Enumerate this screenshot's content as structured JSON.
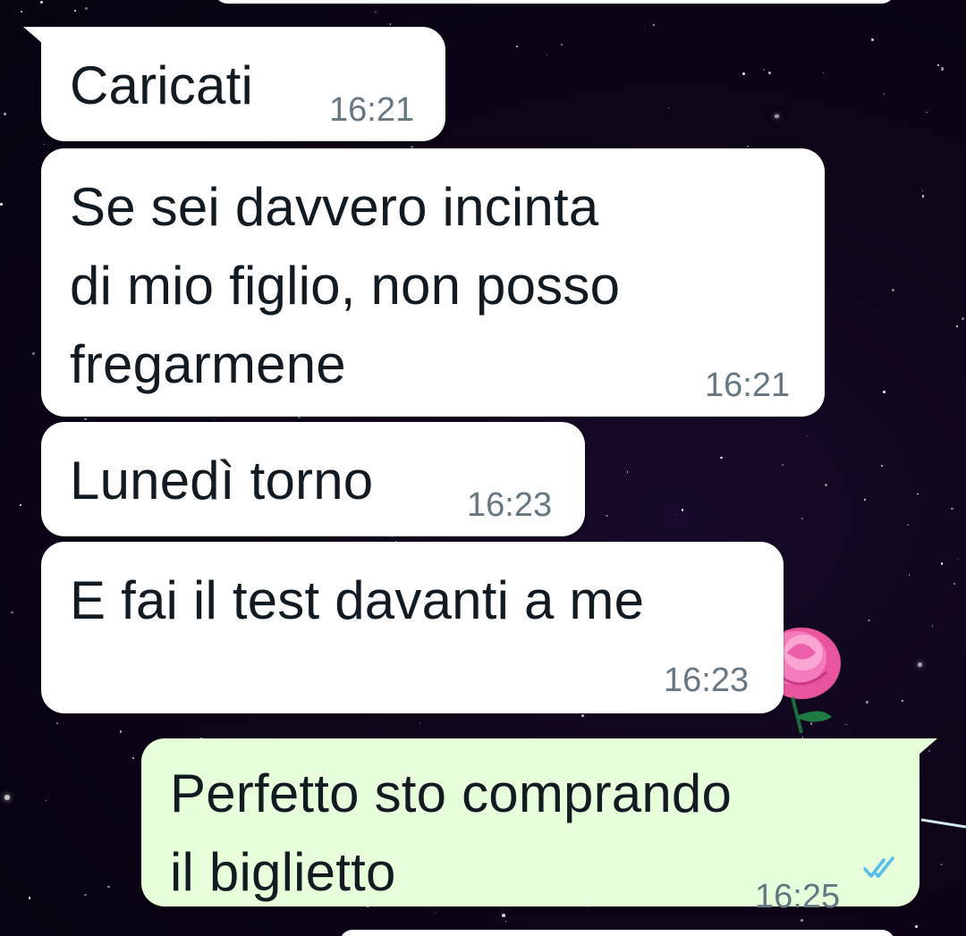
{
  "chat": {
    "messages": [
      {
        "direction": "in",
        "text": "Caricati",
        "time": "16:21"
      },
      {
        "direction": "in",
        "text": "Se sei davvero incinta\ndi mio figlio, non posso\nfregarmene",
        "time": "16:21"
      },
      {
        "direction": "in",
        "text": "Lunedì torno",
        "time": "16:23"
      },
      {
        "direction": "in",
        "text": "E fai il test davanti a me",
        "time": "16:23"
      },
      {
        "direction": "out",
        "text": "Perfetto sto comprando\nil biglietto",
        "time": "16:25",
        "status": "read"
      }
    ]
  },
  "theme": {
    "incoming_bubble": "#ffffff",
    "outgoing_bubble": "#e7ffdb",
    "timestamp_color": "#667781",
    "read_tick_color": "#53bdeb",
    "wallpaper": "#0d0418",
    "rose_color": "#f06bb5"
  },
  "icons": {
    "read_status": "double-check-icon",
    "wallpaper_art": "rose-icon"
  }
}
